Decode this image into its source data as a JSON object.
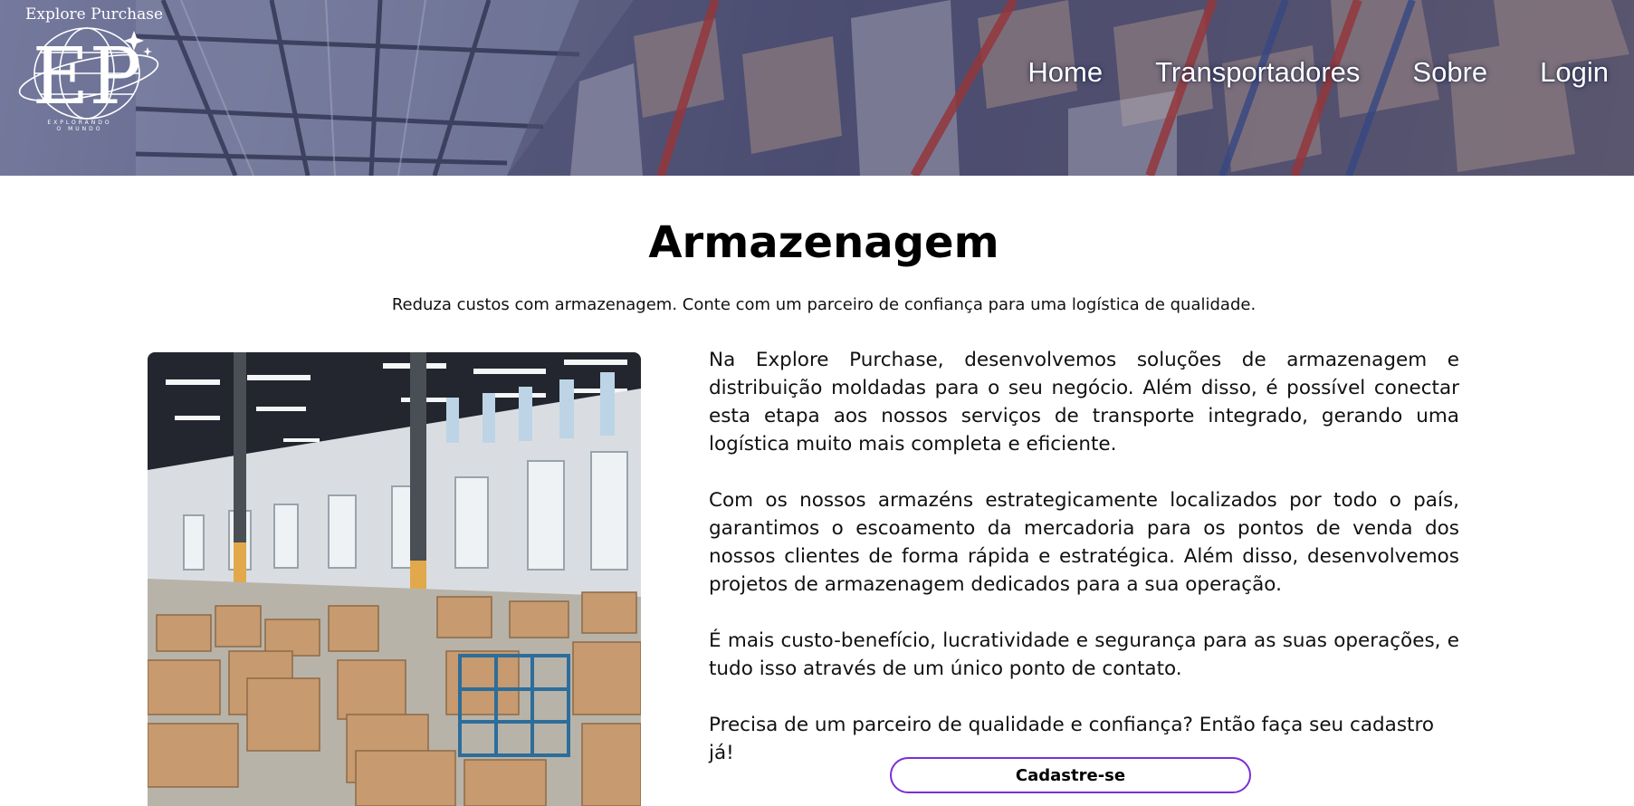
{
  "header": {
    "logo": {
      "brand_text": "Explore Purchase",
      "monogram": "EP",
      "tagline": "EXPLORANDO O MUNDO"
    },
    "nav": [
      {
        "label": "Home"
      },
      {
        "label": "Transportadores"
      },
      {
        "label": "Sobre"
      },
      {
        "label": "Login"
      }
    ]
  },
  "main": {
    "title": "Armazenagem",
    "subtitle": "Reduza custos com armazenagem. Conte com um parceiro de confiança para uma logística de qualidade.",
    "paragraphs": [
      "Na Explore Purchase, desenvolvemos soluções de armazenagem e distribuição moldadas para o seu negócio. Além disso, é possível conectar esta etapa aos nossos serviços de transporte integrado, gerando uma logística muito mais completa e eficiente.",
      "Com os nossos armazéns estrategicamente localizados por todo o país, garantimos o escoamento da mercadoria para os pontos de venda dos nossos clientes de forma rápida e estratégica. Além disso, desenvolvemos projetos de armazenagem dedicados para a sua operação.",
      "É mais custo-benefício, lucratividade e segurança para as suas operações, e tudo isso através de um único ponto de contato.",
      "Precisa de um parceiro de qualidade e confiança? Então faça seu cadastro já!"
    ],
    "cta_label": "Cadastre-se"
  },
  "colors": {
    "accent_border": "#7a2fd6",
    "nav_text": "#ffffff"
  }
}
